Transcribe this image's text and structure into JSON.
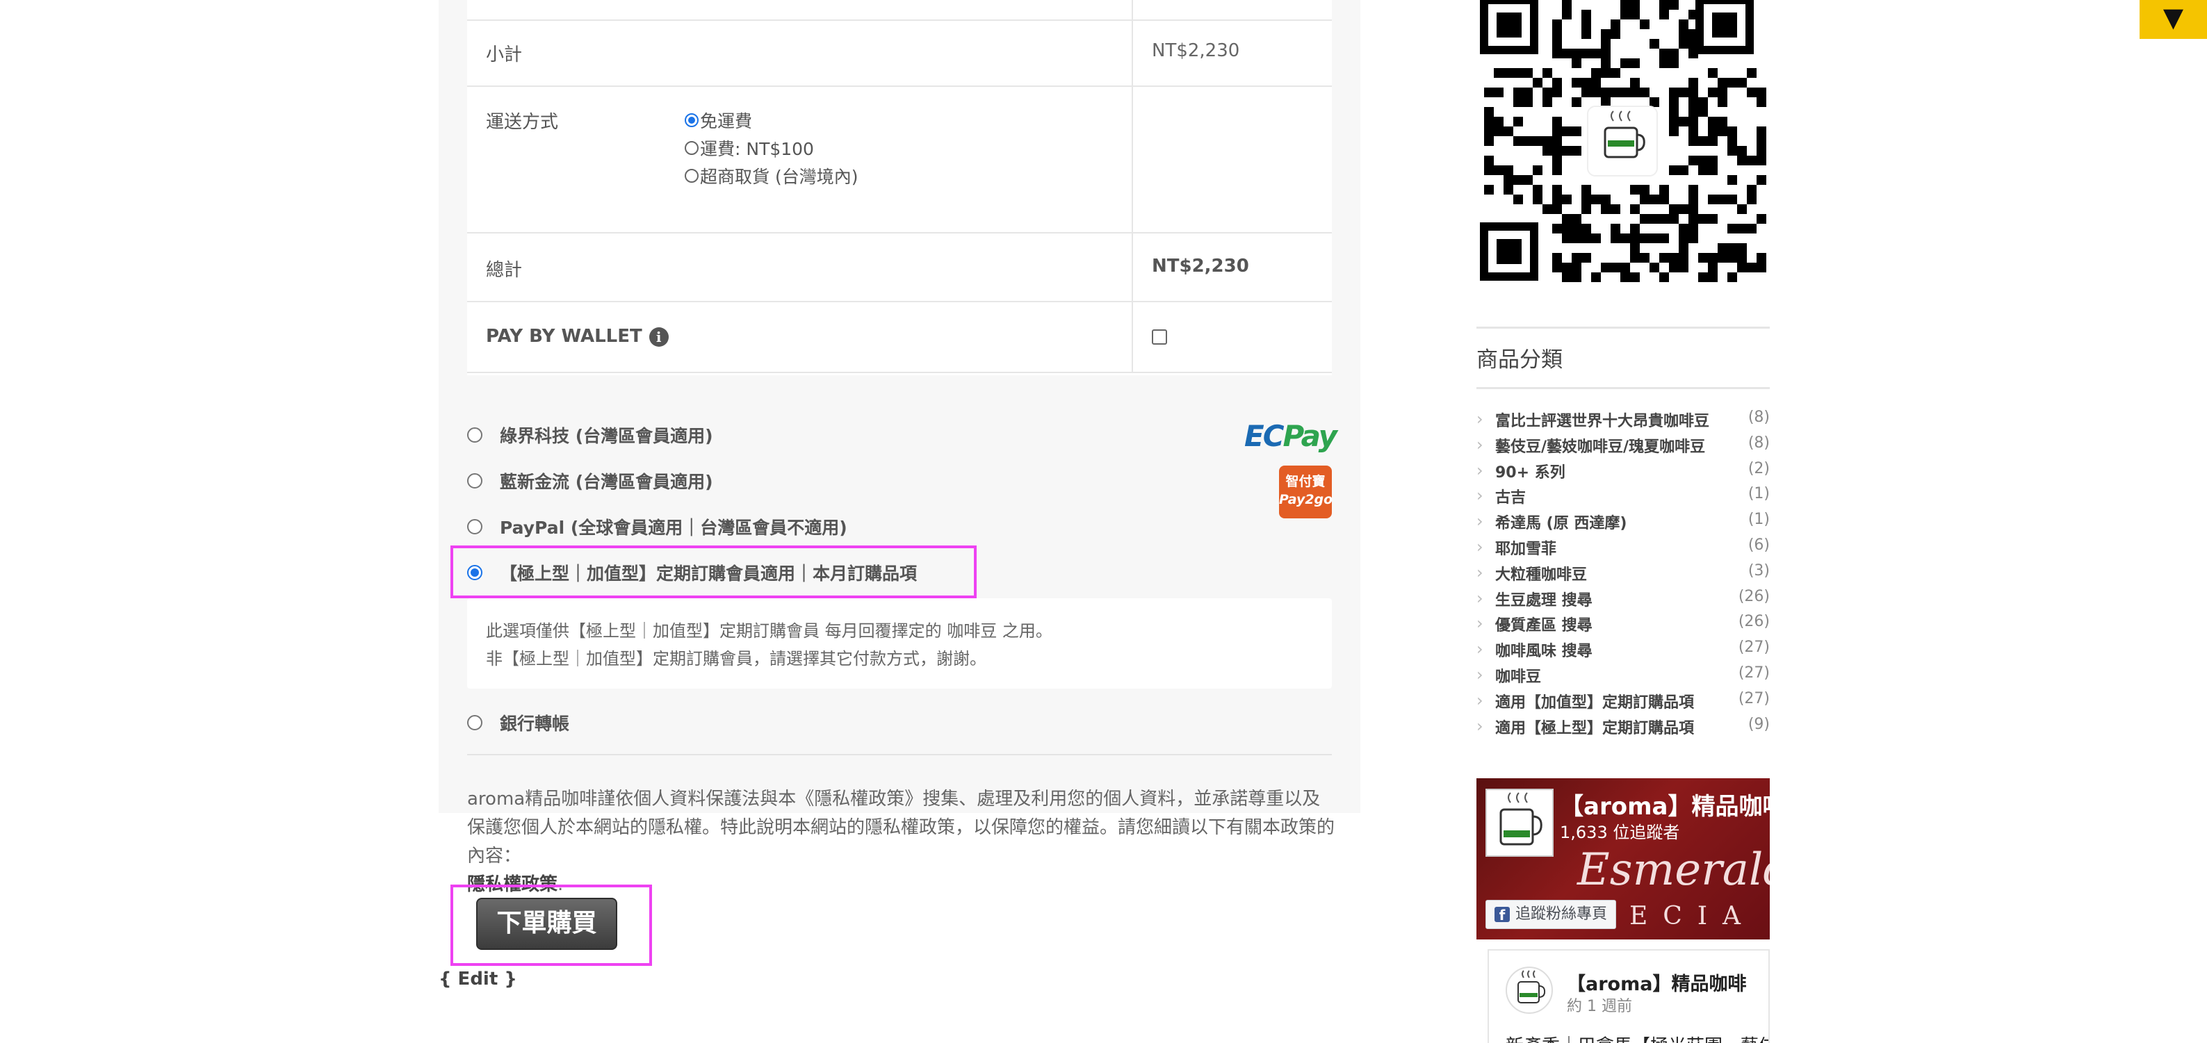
{
  "order_totals": {
    "subtotal_label": "小計",
    "subtotal_value": "NT$2,230",
    "shipping_label": "運送方式",
    "shipping_options": [
      {
        "label": "免運費",
        "selected": true
      },
      {
        "label": "運費: NT$100",
        "selected": false
      },
      {
        "label": "超商取貨 (台灣境內)",
        "selected": false
      }
    ],
    "total_label": "總計",
    "total_value": "NT$2,230",
    "wallet_label": "PAY BY WALLET",
    "wallet_checked": false
  },
  "payment_methods": [
    {
      "label": "綠界科技 (台灣區會員適用)",
      "selected": false
    },
    {
      "label": "藍新金流 (台灣區會員適用)",
      "selected": false
    },
    {
      "label": "PayPal (全球會員適用｜台灣區會員不適用)",
      "selected": false
    },
    {
      "label": "【極上型｜加值型】定期訂購會員適用｜本月訂購品項",
      "selected": true
    },
    {
      "label": "銀行轉帳",
      "selected": false
    }
  ],
  "payment_description": {
    "line1": "此選項僅供【極上型｜加值型】定期訂購會員 每月回覆擇定的 咖啡豆 之用。",
    "line2": "非【極上型｜加值型】定期訂購會員，請選擇其它付款方式，謝謝。"
  },
  "logos": {
    "ecpay_ec": "EC",
    "ecpay_pay": "Pay",
    "pay2go_line1": "智付寶",
    "pay2go_line2": "Pay2go"
  },
  "privacy": {
    "text": "aroma精品咖啡謹依個人資料保護法與本《隱私權政策》搜集、處理及利用您的個人資料，並承諾尊重以及保護您個人於本網站的隱私權。特此說明本網站的隱私權政策，以保障您的權益。請您細讀以下有關本政策的內容：",
    "link": "隱私權政策",
    "period": "."
  },
  "order_button_label": "下單購買",
  "edit_label": "{ Edit }",
  "corner_button_icon": "▼",
  "sidebar": {
    "categories_title": "商品分類",
    "categories": [
      {
        "name": "富比士評選世界十大昂貴咖啡豆",
        "count": "(8)"
      },
      {
        "name": "藝伎豆/藝妓咖啡豆/瑰夏咖啡豆",
        "count": "(8)"
      },
      {
        "name": "90+ 系列",
        "count": "(2)"
      },
      {
        "name": "古吉",
        "count": "(1)"
      },
      {
        "name": "希達馬 (原 西達摩)",
        "count": "(1)"
      },
      {
        "name": "耶加雪菲",
        "count": "(6)"
      },
      {
        "name": "大粒種咖啡豆",
        "count": "(3)"
      },
      {
        "name": "生豆處理 搜尋",
        "count": "(26)"
      },
      {
        "name": "優質產區 搜尋",
        "count": "(26)"
      },
      {
        "name": "咖啡風味 搜尋",
        "count": "(27)"
      },
      {
        "name": "咖啡豆",
        "count": "(27)"
      },
      {
        "name": "適用【加值型】定期訂購品項",
        "count": "(27)"
      },
      {
        "name": "適用【極上型】定期訂購品項",
        "count": "(9)"
      }
    ],
    "facebook": {
      "page_name": "【aroma】精品咖啡",
      "followers": "1,633 位追蹤者",
      "cover_script": "Esmeralda",
      "cover_special": "ECIA",
      "follow_button": "追蹤粉絲專頁",
      "post_author": "【aroma】精品咖啡",
      "post_time": "約 1 週前",
      "post_text": "新產季｜巴拿馬【極光莊園 - 藝伎"
    }
  },
  "colors": {
    "accent_radio": "#1a73e8",
    "highlight": "#ee42f2",
    "corner_button": "#f5c400"
  }
}
